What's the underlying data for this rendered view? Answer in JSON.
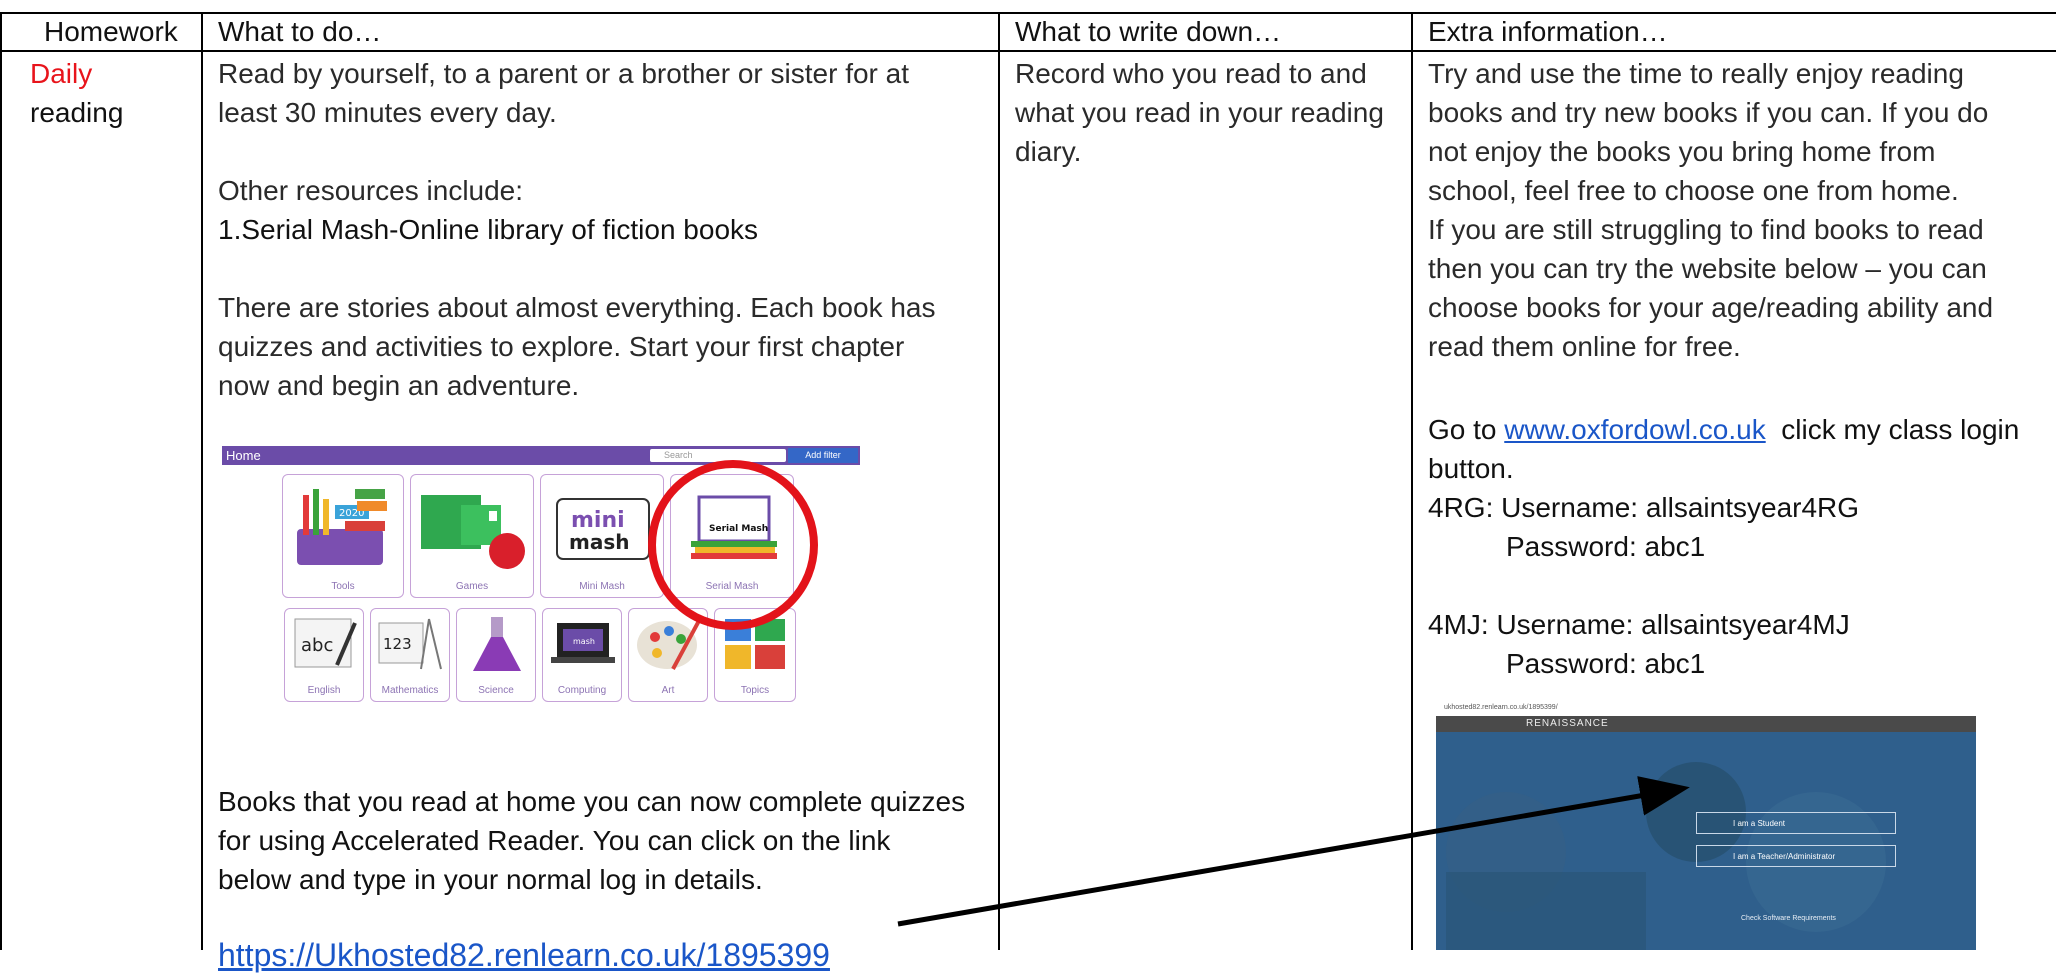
{
  "table": {
    "headers": [
      "Homework",
      "What to do…",
      "What to write down…",
      "Extra information…"
    ],
    "row": {
      "homework_line1": "Daily",
      "homework_line2": "reading",
      "what_to_do": {
        "intro_line1": "Read by yourself, to a parent or a brother or sister for at",
        "intro_line2": "least 30 minutes every day.",
        "other_resources": "Other resources include:",
        "serial_mash_heading": "1.Serial Mash-Online library of fiction books",
        "stories_line1": "There are stories about almost everything.  Each book has",
        "stories_line2": "quizzes and activities to explore. Start your first chapter",
        "stories_line3": "now and begin an adventure.",
        "books_line1": "Books that you read at home you can now complete quizzes",
        "books_line2": "for using Accelerated Reader.  You can click on the link",
        "books_line3": "below and type in your normal log in details.",
        "link": "https://Ukhosted82.renlearn.co.uk/1895399"
      },
      "write_down": {
        "line1": "Record who you read to and",
        "line2": "what you read in your reading",
        "line3": "diary."
      },
      "extra_info": {
        "line1": "Try and use the time to really enjoy reading",
        "line2": "books and try new books if you can. If you do",
        "line3": "not enjoy the books you bring home from",
        "line4": "school, feel free to choose one from home.",
        "line5": "If you are still struggling to find books to read",
        "line6": "then you can try the website below – you can",
        "line7": "choose books for your age/reading ability and",
        "line8": "read them online for free.",
        "goto_prefix": "Go to ",
        "goto_link": "www.oxfordowl.co.uk",
        "goto_suffix": "  click my class login",
        "goto_line2": "button.",
        "rg_username": "4RG:  Username: allsaintsyear4RG",
        "rg_password": "Password: abc1",
        "mj_username": "4MJ: Username: allsaintsyear4MJ",
        "mj_password": "Password: abc1"
      }
    }
  },
  "serial_mash_screenshot": {
    "bar_title": "Home",
    "search_placeholder": "Search",
    "filter_button": "Add filter",
    "tiles_top": [
      "Tools",
      "Games",
      "Mini Mash",
      "Serial Mash"
    ],
    "tiles_bottom": [
      "English",
      "Mathematics",
      "Science",
      "Computing",
      "Art",
      "Topics"
    ],
    "mini_label_1": "mini",
    "mini_label_2": "mash",
    "serial_mash_book": "Serial Mash",
    "tools_year": "2020",
    "abc_text": "abc",
    "num_text": "123",
    "computing_screen": "mash"
  },
  "renaissance_screenshot": {
    "url": "ukhosted82.renlearn.co.uk/1895399/",
    "brand": "RENAISSANCE",
    "student_button": "I am a Student",
    "teacher_button": "I am a Teacher/Administrator",
    "requirements": "Check Software Requirements"
  },
  "colors": {
    "accent_red": "#e8141b",
    "link_blue": "#1a56c8",
    "serial_mash_purple": "#6b4ca8"
  }
}
